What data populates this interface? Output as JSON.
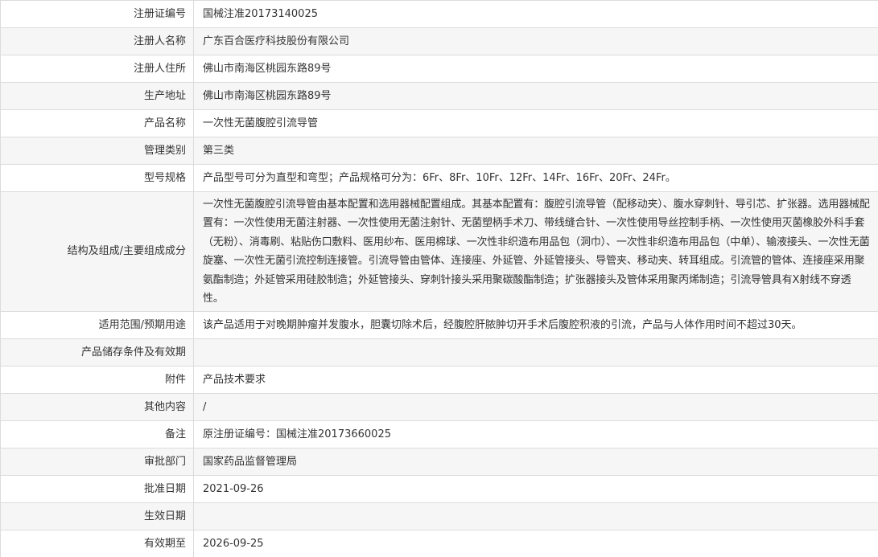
{
  "rows": [
    {
      "label": "注册证编号",
      "value": "国械注准20173140025"
    },
    {
      "label": "注册人名称",
      "value": "广东百合医疗科技股份有限公司"
    },
    {
      "label": "注册人住所",
      "value": "佛山市南海区桃园东路89号"
    },
    {
      "label": "生产地址",
      "value": "佛山市南海区桃园东路89号"
    },
    {
      "label": "产品名称",
      "value": "一次性无菌腹腔引流导管"
    },
    {
      "label": "管理类别",
      "value": "第三类"
    },
    {
      "label": "型号规格",
      "value": "产品型号可分为直型和弯型；产品规格可分为：6Fr、8Fr、10Fr、12Fr、14Fr、16Fr、20Fr、24Fr。"
    },
    {
      "label": "结构及组成/主要组成成分",
      "value": "一次性无菌腹腔引流导管由基本配置和选用器械配置组成。其基本配置有：腹腔引流导管（配移动夹）、腹水穿刺针、导引芯、扩张器。选用器械配置有：一次性使用无菌注射器、一次性使用无菌注射针、无菌塑柄手术刀、带线缝合针、一次性使用导丝控制手柄、一次性使用灭菌橡胶外科手套（无粉）、消毒刷、粘贴伤口敷料、医用纱布、医用棉球、一次性非织造布用品包（洞巾）、一次性非织造布用品包（中单）、输液接头、一次性无菌旋塞、一次性无菌引流控制连接管。引流导管由管体、连接座、外延管、外延管接头、导管夹、移动夹、转耳组成。引流管的管体、连接座采用聚氨酯制造；外延管采用硅胶制造；外延管接头、穿刺针接头采用聚碳酸酯制造；扩张器接头及管体采用聚丙烯制造；引流导管具有X射线不穿透性。"
    },
    {
      "label": "适用范围/预期用途",
      "value": "该产品适用于对晚期肿瘤并发腹水，胆囊切除术后，经腹腔肝脓肿切开手术后腹腔积液的引流，产品与人体作用时间不超过30天。"
    },
    {
      "label": "产品储存条件及有效期",
      "value": ""
    },
    {
      "label": "附件",
      "value": "产品技术要求"
    },
    {
      "label": "其他内容",
      "value": "/"
    },
    {
      "label": "备注",
      "value": "原注册证编号：国械注准20173660025"
    },
    {
      "label": "审批部门",
      "value": "国家药品监督管理局"
    },
    {
      "label": "批准日期",
      "value": "2021-09-26"
    },
    {
      "label": "生效日期",
      "value": ""
    },
    {
      "label": "有效期至",
      "value": "2026-09-25"
    }
  ]
}
